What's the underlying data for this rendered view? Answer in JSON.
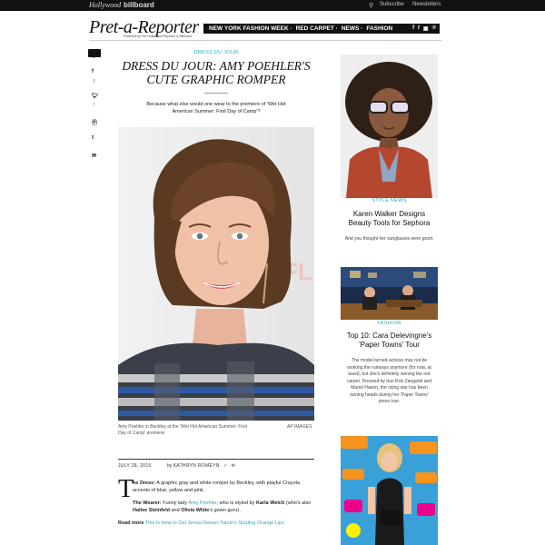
{
  "topbar": {
    "brand_hollywood": "Hollywood",
    "brand_billboard": "billboard",
    "subscribe": "Subscribe",
    "newsletters": "Newsletters",
    "search_icon": "search-icon"
  },
  "site": {
    "logo": "Pret-a-Reporter",
    "tagline": "Powered by The Hollywood Reporter & Billboard"
  },
  "nav": {
    "items": [
      "NEW YORK FASHION WEEK ·",
      "RED CARPET ·",
      "NEWS ·",
      "FASHION"
    ],
    "icons": [
      "facebook-icon",
      "twitter-icon",
      "instagram-icon",
      "pinterest-icon"
    ]
  },
  "share": {
    "facebook_count": "3",
    "twitter_count": "7"
  },
  "article": {
    "kicker": "DRESS DU JOUR",
    "headline": "DRESS DU JOUR: AMY POEHLER'S CUTE GRAPHIC ROMPER",
    "dek": "Because what else would one wear to the premiere of 'Wet Hot American Summer: First Day of Camp'?",
    "caption": "Amy Poehler in Beckley at the 'Wet Hot American Summer: First Day of Camp' premiere",
    "credit": "AP IMAGES",
    "date": "JULY 28, 2015",
    "byline_prefix": "by",
    "author": "KATHRYN ROMEYN",
    "dropcap": "T",
    "p1_lead": "he Dress:",
    "p1_text": " A graphic gray and white romper by Beckley, with playful Crayola accents of blue, yellow and pink.",
    "p2_lead": "The Wearer:",
    "p2_a": " Funny lady ",
    "p2_link": "Amy Poehler",
    "p2_b": ", who is styled by ",
    "p2_stylist": "Karla Welch",
    "p2_c": " (who's also ",
    "p2_hs": "Hailee Steinfeld",
    "p2_d": " and ",
    "p2_ow": "Olivia Wilde",
    "p2_e": "'s gown guru).",
    "readmore_lead": "Read more",
    "readmore_link": "This Is How to Get Jenna Dewan-Tatum's Sizzling Orange Lips"
  },
  "sidebar": {
    "cards": [
      {
        "tag": "STYLE NEWS",
        "title": "Karen Walker Designs Beauty Tools for Sephora",
        "desc": "And you thought her sunglasses were good."
      },
      {
        "tag": "FASHION",
        "title": "Top 10: Cara Delevingne's 'Paper Towns' Tour",
        "desc": "The model-turned-actress may not be working the runways anymore (for now, at least), but she's definitely owning the red carpet. Dressed by duo Rob Zangardi and Mariel Haenn, the rising star has been turning heads during her 'Paper Towns' press tour."
      }
    ]
  },
  "colors": {
    "accent": "#2aa7b8",
    "topbar": "#111111"
  }
}
